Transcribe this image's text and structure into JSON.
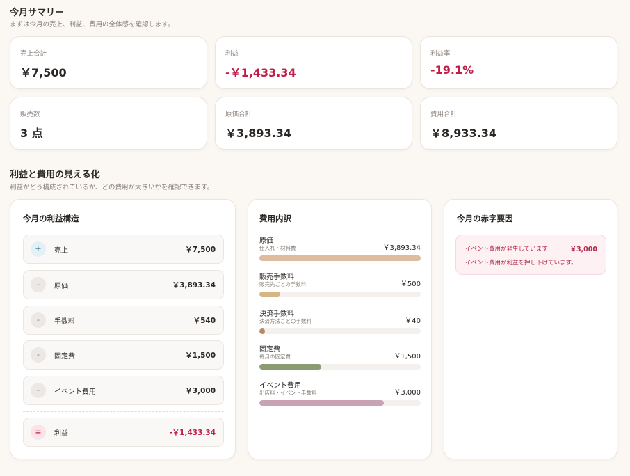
{
  "summary": {
    "title": "今月サマリー",
    "subtitle": "まずは今月の売上、利益、費用の全体感を確認します。",
    "cards": [
      {
        "label": "売上合計",
        "value": "￥7,500",
        "negative": false
      },
      {
        "label": "利益",
        "value": "-￥1,433.34",
        "negative": true
      },
      {
        "label": "利益率",
        "value": "-19.1%",
        "negative": true
      },
      {
        "label": "販売数",
        "value": "3 点",
        "negative": false
      },
      {
        "label": "原価合計",
        "value": "￥3,893.34",
        "negative": false
      },
      {
        "label": "費用合計",
        "value": "￥8,933.34",
        "negative": false
      }
    ]
  },
  "visualize": {
    "title": "利益と費用の見える化",
    "subtitle": "利益がどう構成されているか、どの費用が大きいかを確認できます。"
  },
  "profit_structure": {
    "title": "今月の利益構造",
    "rows": [
      {
        "sign": "+",
        "label": "売上",
        "amount": "￥7,500"
      },
      {
        "sign": "-",
        "label": "原価",
        "amount": "￥3,893.34"
      },
      {
        "sign": "-",
        "label": "手数料",
        "amount": "￥540"
      },
      {
        "sign": "-",
        "label": "固定費",
        "amount": "￥1,500"
      },
      {
        "sign": "-",
        "label": "イベント費用",
        "amount": "￥3,000"
      }
    ],
    "result": {
      "sign": "=",
      "label": "利益",
      "amount": "-￥1,433.34"
    }
  },
  "cost_breakdown": {
    "title": "費用内訳",
    "items": [
      {
        "name": "原価",
        "desc": "仕入れ・材料費",
        "amount": "￥3,893.34",
        "share": 1.0,
        "color": "#ddbca0"
      },
      {
        "name": "販売手数料",
        "desc": "販売先ごとの手数料",
        "amount": "￥500",
        "share": 0.128,
        "color": "#d8b585"
      },
      {
        "name": "決済手数料",
        "desc": "決済方法ごとの手数料",
        "amount": "￥40",
        "share": 0.01,
        "color": "#b98a60"
      },
      {
        "name": "固定費",
        "desc": "毎月の固定費",
        "amount": "￥1,500",
        "share": 0.385,
        "color": "#8c9c71"
      },
      {
        "name": "イベント費用",
        "desc": "出店料・イベント手数料",
        "amount": "￥3,000",
        "share": 0.77,
        "color": "#c9a3b3"
      }
    ]
  },
  "deficit_factors": {
    "title": "今月の赤字要因",
    "line1": "イベント費用が発生しています",
    "amount": "￥3,000",
    "line2": "イベント費用が利益を押し下げています。"
  }
}
